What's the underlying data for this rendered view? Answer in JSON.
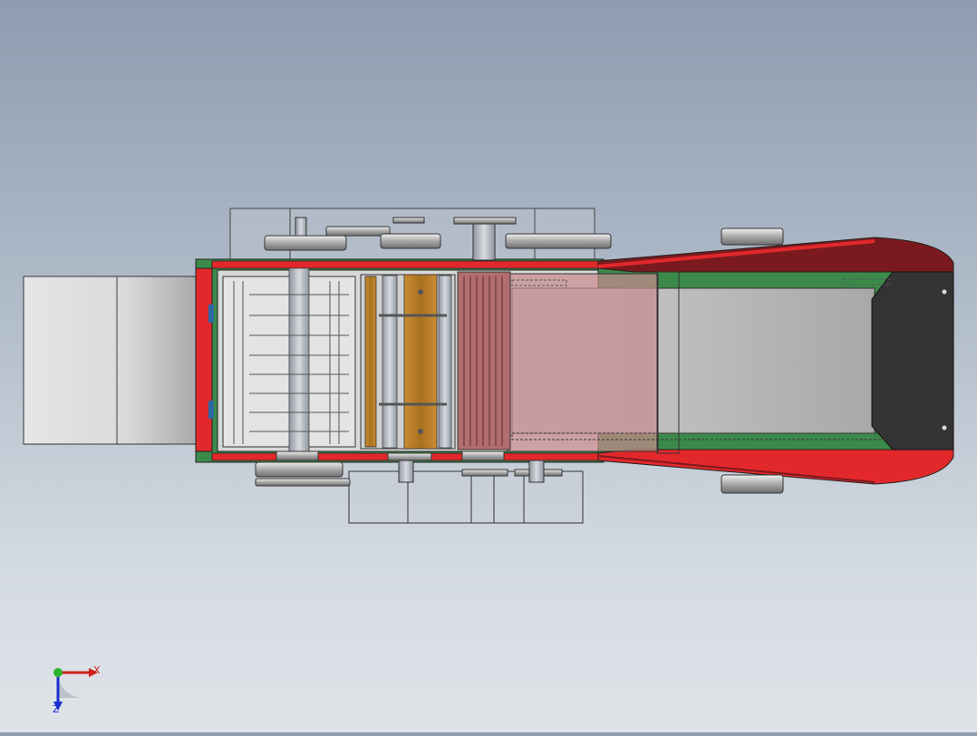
{
  "view": {
    "kind": "cad-top-view",
    "background_top": "#8e9cb0",
    "background_bottom": "#dfe3e8"
  },
  "colors": {
    "frame_red": "#e3282b",
    "frame_dark_red": "#7a1a1e",
    "frame_green": "#3c8a4a",
    "hopper_gray": "#d9d9d9",
    "belt_gray": "#bdbdbd",
    "roller_brown": "#b07a2a",
    "pink_panel": "#c98a8d",
    "guard_dark": "#333333"
  },
  "triad": {
    "x_label": "X",
    "z_label": "Z"
  }
}
